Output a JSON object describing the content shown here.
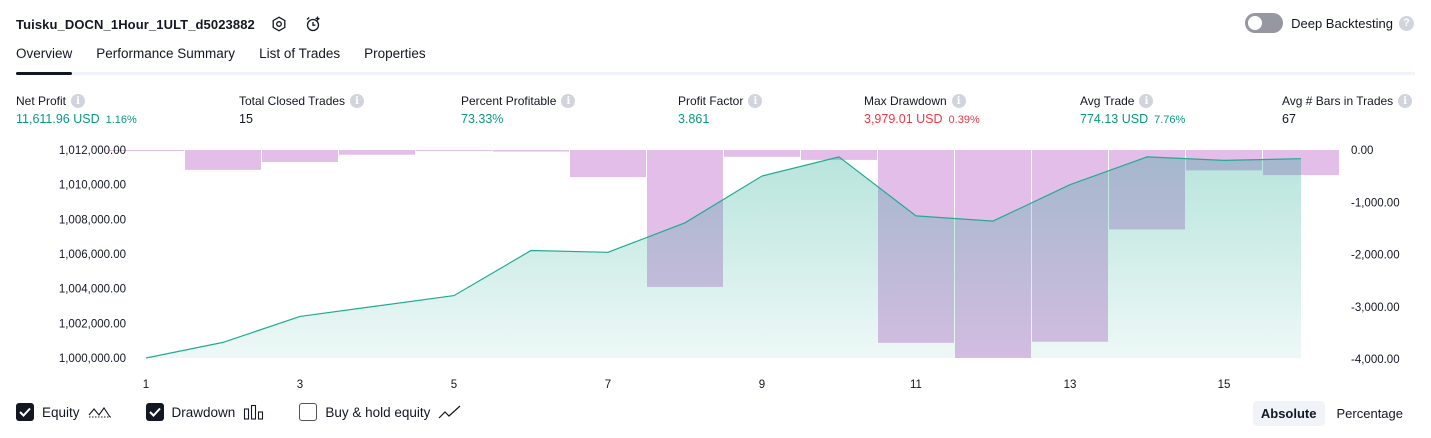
{
  "header": {
    "title": "Tuisku_DOCN_1Hour_1ULT_d5023882",
    "deep_backtesting_label": "Deep Backtesting",
    "deep_backtesting_enabled": false
  },
  "tabs": [
    {
      "label": "Overview",
      "active": true
    },
    {
      "label": "Performance Summary",
      "active": false
    },
    {
      "label": "List of Trades",
      "active": false
    },
    {
      "label": "Properties",
      "active": false
    }
  ],
  "stats": [
    {
      "label": "Net Profit",
      "value": "11,611.96 USD",
      "sub": "1.16%",
      "color": "#089981"
    },
    {
      "label": "Total Closed Trades",
      "value": "15",
      "sub": "",
      "color": "#131722"
    },
    {
      "label": "Percent Profitable",
      "value": "73.33%",
      "sub": "",
      "color": "#089981"
    },
    {
      "label": "Profit Factor",
      "value": "3.861",
      "sub": "",
      "color": "#089981"
    },
    {
      "label": "Max Drawdown",
      "value": "3,979.01 USD",
      "sub": "0.39%",
      "color": "#f23645"
    },
    {
      "label": "Avg Trade",
      "value": "774.13 USD",
      "sub": "7.76%",
      "color": "#089981"
    },
    {
      "label": "Avg # Bars in Trades",
      "value": "67",
      "sub": "",
      "color": "#131722"
    }
  ],
  "chart_data": {
    "type": "area",
    "x": [
      1,
      2,
      3,
      4,
      5,
      6,
      7,
      8,
      9,
      10,
      11,
      12,
      13,
      14,
      15,
      16
    ],
    "x_ticks": [
      "1",
      "3",
      "5",
      "7",
      "9",
      "11",
      "13",
      "15"
    ],
    "left_axis": {
      "ticks": [
        "1,012,000.00",
        "1,010,000.00",
        "1,008,000.00",
        "1,006,000.00",
        "1,004,000.00",
        "1,002,000.00",
        "1,000,000.00"
      ],
      "ylim": [
        1000000,
        1012000
      ]
    },
    "right_axis": {
      "ticks": [
        "0.00",
        "-1,000.00",
        "-2,000.00",
        "-3,000.00",
        "-4,000.00"
      ],
      "ylim": [
        -4000,
        0
      ]
    },
    "series": [
      {
        "name": "Equity",
        "kind": "area",
        "axis": "left",
        "color": "#22ab94",
        "values": [
          1000000,
          1000900,
          1002400,
          1003000,
          1003600,
          1006200,
          1006100,
          1007800,
          1010500,
          1011600,
          1008200,
          1007900,
          1010000,
          1011600,
          1011400,
          1011500
        ]
      },
      {
        "name": "Drawdown",
        "kind": "bar",
        "axis": "right",
        "color": "#ce93d8",
        "values": [
          -20,
          -380,
          -230,
          -90,
          -10,
          -30,
          -520,
          -2620,
          -130,
          -190,
          -3690,
          -3980,
          -3670,
          -1520,
          -390,
          -480
        ]
      }
    ],
    "grid": false
  },
  "legend": [
    {
      "label": "Equity",
      "checked": true,
      "icon": "equity-line-icon"
    },
    {
      "label": "Drawdown",
      "checked": true,
      "icon": "drawdown-bars-icon"
    },
    {
      "label": "Buy & hold equity",
      "checked": false,
      "icon": "buy-hold-line-icon"
    }
  ],
  "mode": {
    "absolute_label": "Absolute",
    "percentage_label": "Percentage",
    "selected": "Absolute"
  }
}
